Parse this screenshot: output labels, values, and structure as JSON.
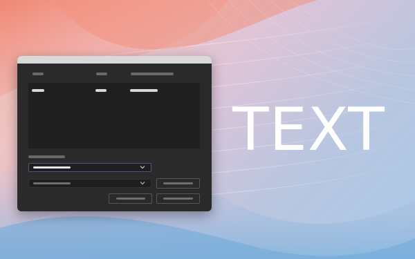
{
  "overlay": {
    "text": "TEXT"
  },
  "dialog": {
    "columns": [
      "",
      "",
      ""
    ],
    "rows": [
      [
        "",
        "",
        ""
      ]
    ],
    "section_label": "",
    "primary_select": {
      "value": ""
    },
    "secondary_select": {
      "value": ""
    },
    "buttons": [
      "",
      "",
      ""
    ]
  },
  "colors": {
    "dialog_background": "#2a2a2a",
    "list_background": "#1f1f1f",
    "titlebar": "#d9d9d9",
    "overlay_text": "#ffffff"
  }
}
